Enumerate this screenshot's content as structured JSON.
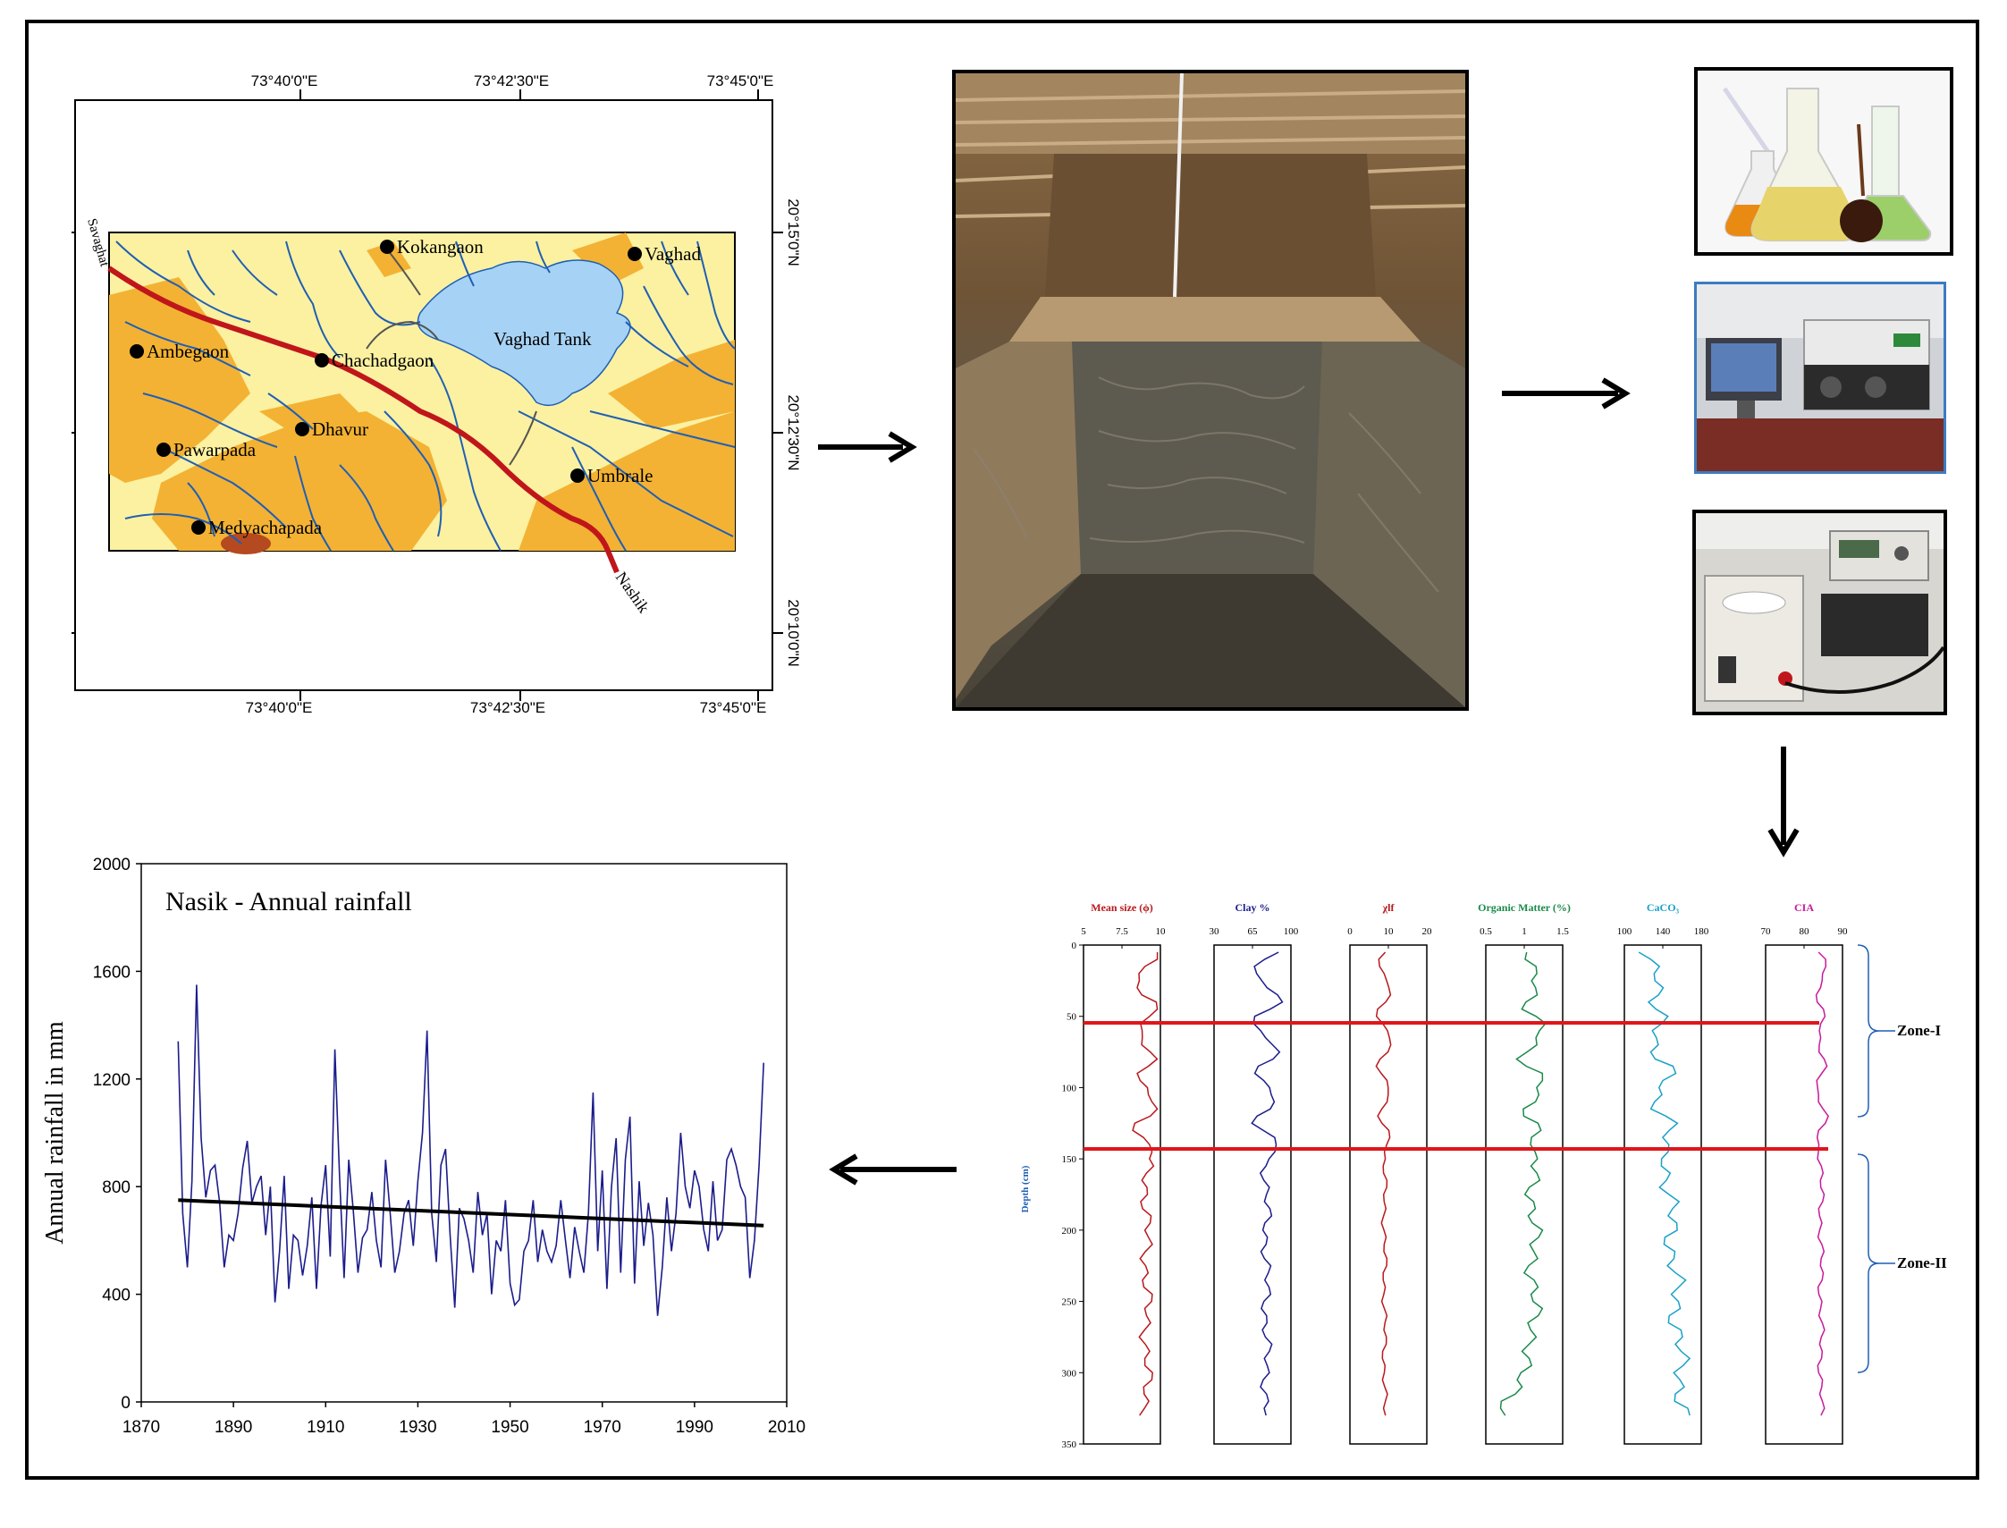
{
  "map": {
    "lon_labels": [
      "73°40'0\"E",
      "73°42'30\"E",
      "73°45'0\"E"
    ],
    "lat_labels": [
      "20°15'0\"N",
      "20°12'30\"N",
      "20°10'0\"N"
    ],
    "villages": [
      "Kokangaon",
      "Vaghad",
      "Ambegaon",
      "Chachadgaon",
      "Dhavur",
      "Pawarpada",
      "Umbrale",
      "Medyachapada"
    ],
    "water_body": "Vaghad Tank",
    "roads": [
      "Savaghat",
      "Nashik"
    ],
    "colors": {
      "river": "#1f5fb5",
      "road": "#c0161b",
      "upland": "#f3b233",
      "lowland": "#fbf1a0",
      "tank": "#a6d3f5"
    }
  },
  "photos": {
    "trench": "soil-trench-photo",
    "lab1": "lab-flasks-photo",
    "lab2": "analyzer-instrument-photo",
    "lab3": "susceptibility-meter-photo"
  },
  "profile": {
    "depth_label": "Depth (cm)",
    "depth_ticks": [
      "0",
      "50",
      "100",
      "150",
      "200",
      "250",
      "300",
      "350"
    ],
    "zones": [
      "Zone-I",
      "Zone-II"
    ],
    "panels": [
      {
        "title": "Mean size (ϕ)",
        "color": "#b8181c",
        "ticks": [
          "5",
          "7.5",
          "10"
        ]
      },
      {
        "title": "Clay %",
        "color": "#1c1c8c",
        "ticks": [
          "30",
          "65",
          "100"
        ]
      },
      {
        "title": "χlf",
        "color": "#b8181c",
        "ticks": [
          "0",
          "10",
          "20"
        ]
      },
      {
        "title": "Organic Matter (%)",
        "color": "#1a8a4a",
        "ticks": [
          "0.5",
          "1",
          "1.5"
        ]
      },
      {
        "title": "CaCO₃",
        "color": "#1aa0c8",
        "ticks": [
          "100",
          "140",
          "180"
        ]
      },
      {
        "title": "CIA",
        "color": "#c81a9a",
        "ticks": [
          "70",
          "80",
          "90"
        ]
      }
    ]
  },
  "chart_data": {
    "type": "line",
    "title": "Nasik - Annual rainfall",
    "xlabel": "",
    "ylabel": "Annual rainfall in mm",
    "xlim": [
      1870,
      2010
    ],
    "ylim": [
      0,
      2000
    ],
    "x_ticks": [
      "1870",
      "1890",
      "1910",
      "1930",
      "1950",
      "1970",
      "1990",
      "2010"
    ],
    "y_ticks": [
      "0",
      "400",
      "800",
      "1200",
      "1600",
      "2000"
    ],
    "series": [
      {
        "color": "#1c1c8c",
        "x": [
          1878,
          1879,
          1880,
          1881,
          1882,
          1883,
          1884,
          1885,
          1886,
          1887,
          1888,
          1889,
          1890,
          1891,
          1892,
          1893,
          1894,
          1895,
          1896,
          1897,
          1898,
          1899,
          1900,
          1901,
          1902,
          1903,
          1904,
          1905,
          1906,
          1907,
          1908,
          1909,
          1910,
          1911,
          1912,
          1913,
          1914,
          1915,
          1916,
          1917,
          1918,
          1919,
          1920,
          1921,
          1922,
          1923,
          1924,
          1925,
          1926,
          1927,
          1928,
          1929,
          1930,
          1931,
          1932,
          1933,
          1934,
          1935,
          1936,
          1937,
          1938,
          1939,
          1940,
          1941,
          1942,
          1943,
          1944,
          1945,
          1946,
          1947,
          1948,
          1949,
          1950,
          1951,
          1952,
          1953,
          1954,
          1955,
          1956,
          1957,
          1958,
          1959,
          1960,
          1961,
          1962,
          1963,
          1964,
          1965,
          1966,
          1967,
          1968,
          1969,
          1970,
          1971,
          1972,
          1973,
          1974,
          1975,
          1976,
          1977,
          1978,
          1979,
          1980,
          1981,
          1982,
          1983,
          1984,
          1985,
          1986,
          1987,
          1988,
          1989,
          1990,
          1991,
          1992,
          1993,
          1994,
          1995,
          1996,
          1997,
          1998,
          1999,
          2000,
          2001,
          2002,
          2003,
          2004,
          2005
        ],
        "y": [
          1340,
          700,
          500,
          820,
          1550,
          980,
          760,
          860,
          880,
          740,
          500,
          620,
          600,
          700,
          870,
          970,
          740,
          800,
          840,
          620,
          800,
          370,
          560,
          840,
          420,
          620,
          600,
          470,
          580,
          760,
          420,
          730,
          880,
          540,
          1310,
          840,
          460,
          900,
          710,
          480,
          610,
          640,
          780,
          600,
          500,
          900,
          700,
          480,
          560,
          700,
          750,
          580,
          820,
          1000,
          1380,
          700,
          520,
          880,
          940,
          620,
          350,
          720,
          680,
          600,
          480,
          780,
          620,
          700,
          400,
          600,
          560,
          750,
          440,
          360,
          380,
          560,
          600,
          750,
          520,
          640,
          560,
          520,
          580,
          750,
          600,
          460,
          650,
          560,
          480,
          700,
          1150,
          560,
          860,
          420,
          800,
          980,
          480,
          900,
          1060,
          440,
          820,
          580,
          740,
          620,
          320,
          500,
          760,
          560,
          700,
          1000,
          800,
          720,
          860,
          800,
          640,
          560,
          820,
          600,
          640,
          900,
          940,
          880,
          800,
          760,
          460,
          600,
          880,
          1260
        ]
      },
      {
        "name": "",
        "color": "#000000",
        "x": [
          1878,
          2005
        ],
        "y": [
          750,
          655
        ]
      }
    ]
  }
}
